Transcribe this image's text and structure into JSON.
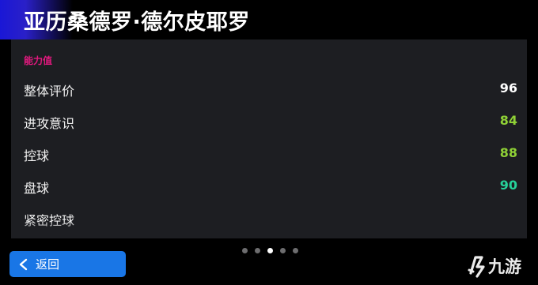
{
  "header": {
    "title": "亚历桑德罗·德尔皮耶罗"
  },
  "section": {
    "label": "能力值"
  },
  "stats": [
    {
      "name": "整体评价",
      "value": "96",
      "color": "#ffffff"
    },
    {
      "name": "进攻意识",
      "value": "84",
      "color": "#8fd136"
    },
    {
      "name": "控球",
      "value": "88",
      "color": "#8fd136"
    },
    {
      "name": "盘球",
      "value": "90",
      "color": "#27d29a"
    },
    {
      "name": "紧密控球",
      "value": "",
      "color": "#27d29a"
    }
  ],
  "pager": {
    "count": 5,
    "active_index": 2
  },
  "footer": {
    "back_label": "返回"
  },
  "watermark": {
    "text": "九游"
  },
  "colors": {
    "accent_pink": "#e3197f",
    "button_blue": "#1976e6",
    "panel_bg": "#1d1e22",
    "header_accent": "#1a17d6"
  }
}
